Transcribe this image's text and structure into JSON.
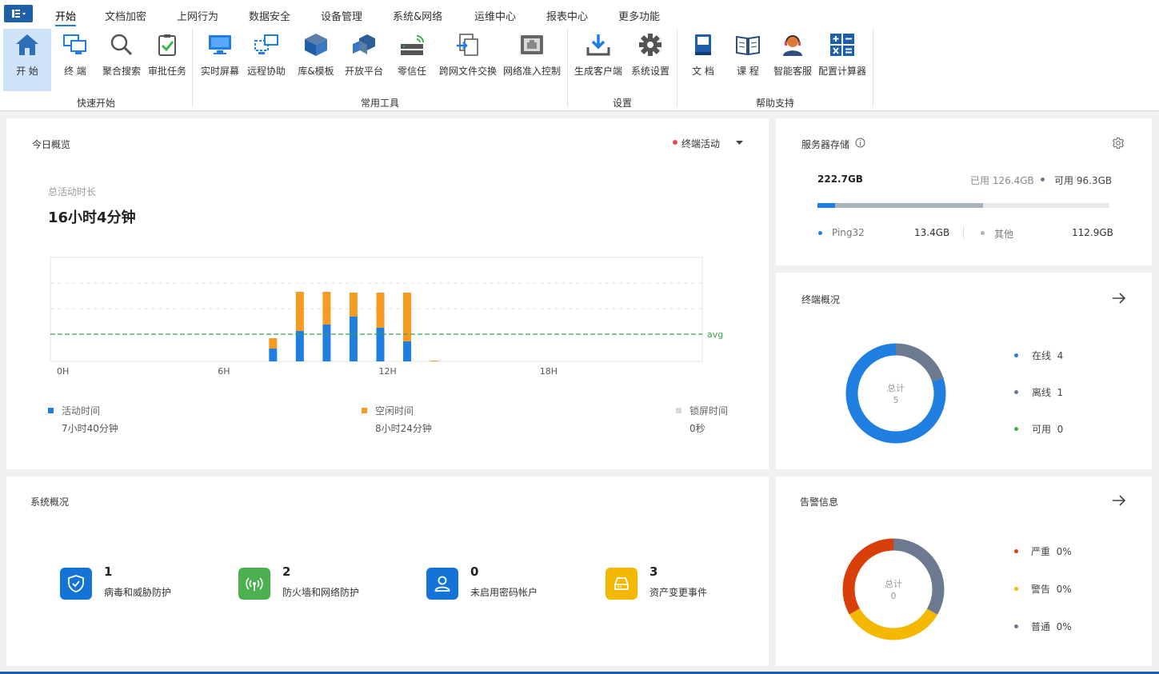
{
  "ribbon": {
    "tabs": [
      "开始",
      "文档加密",
      "上网行为",
      "数据安全",
      "设备管理",
      "系统&网络",
      "运维中心",
      "报表中心",
      "更多功能"
    ],
    "tools": [
      {
        "label": "开 始",
        "icon": "home-icon"
      },
      {
        "label": "终 端",
        "icon": "terminal-icon"
      },
      {
        "label": "聚合搜索",
        "icon": "search-icon"
      },
      {
        "label": "审批任务",
        "icon": "approval-icon"
      },
      {
        "label": "实时屏幕",
        "icon": "monitor-icon"
      },
      {
        "label": "远程协助",
        "icon": "remote-icon"
      },
      {
        "label": "库&模板",
        "icon": "library-icon"
      },
      {
        "label": "开放平台",
        "icon": "platform-icon"
      },
      {
        "label": "零信任",
        "icon": "zero-trust-icon"
      },
      {
        "label": "跨网文件交换",
        "icon": "file-exchange-icon"
      },
      {
        "label": "网络准入控制",
        "icon": "network-access-icon"
      },
      {
        "label": "生成客户端",
        "icon": "download-icon"
      },
      {
        "label": "系统设置",
        "icon": "gear-icon"
      },
      {
        "label": "文 档",
        "icon": "document-icon"
      },
      {
        "label": "课 程",
        "icon": "course-icon"
      },
      {
        "label": "智能客服",
        "icon": "support-icon"
      },
      {
        "label": "配置计算器",
        "icon": "calculator-icon"
      }
    ],
    "groups": [
      "快速开始",
      "常用工具",
      "设置",
      "帮助支持"
    ]
  },
  "today": {
    "title": "今日概览",
    "selector": "终端活动",
    "total_label": "总活动时长",
    "total_value": "16小时4分钟",
    "legend": [
      {
        "label": "活动时间",
        "value": "7小时40分钟",
        "color": "#1e7fe0"
      },
      {
        "label": "空闲时间",
        "value": "8小时24分钟",
        "color": "#f59a23"
      },
      {
        "label": "锁屏时间",
        "value": "0秒",
        "color": "#d9d9d9"
      }
    ]
  },
  "chart_data": {
    "type": "bar",
    "stacked": true,
    "x": [
      8,
      9,
      10,
      11,
      12,
      13,
      14
    ],
    "xticks": [
      "0H",
      "6H",
      "12H",
      "18H"
    ],
    "xlim": [
      0,
      24
    ],
    "series": [
      {
        "name": "活动时间",
        "color": "#1e7fe0",
        "values": [
          16,
          38,
          46,
          56,
          42,
          25,
          0
        ]
      },
      {
        "name": "空闲时间",
        "color": "#f59a23",
        "values": [
          13,
          49,
          41,
          30,
          44,
          61,
          1
        ]
      }
    ],
    "ylim": [
      0,
      130
    ],
    "avg_value": 34,
    "avg_label": "avg",
    "grid": true
  },
  "storage": {
    "title": "服务器存储",
    "total": "222.7GB",
    "used_label": "已用",
    "used": "126.4GB",
    "free_label": "可用",
    "free": "96.3GB",
    "used_gb": 126.4,
    "total_gb": 222.7,
    "ping32_gb": 13.4,
    "items": [
      {
        "label": "Ping32",
        "value": "13.4GB",
        "color": "#1e7fe0"
      },
      {
        "label": "其他",
        "value": "112.9GB",
        "color": "#a9b1bd"
      }
    ]
  },
  "terminal": {
    "title": "终端概况",
    "center_label": "总计",
    "center_value": "5",
    "items": [
      {
        "label": "在线",
        "value": "4",
        "count": 4,
        "color": "#1e7fe0"
      },
      {
        "label": "离线",
        "value": "1",
        "count": 1,
        "color": "#6b7a8f"
      },
      {
        "label": "可用",
        "value": "0",
        "count": 0,
        "color": "#3cb44b"
      }
    ]
  },
  "system": {
    "title": "系统概况",
    "stats": [
      {
        "value": "1",
        "label": "病毒和威胁防护",
        "color": "#1473d6",
        "icon": "shield-icon"
      },
      {
        "value": "2",
        "label": "防火墙和网络防护",
        "color": "#4caf50",
        "icon": "wifi-icon"
      },
      {
        "value": "0",
        "label": "未启用密码帐户",
        "color": "#1473d6",
        "icon": "user-icon"
      },
      {
        "value": "3",
        "label": "资产变更事件",
        "color": "#f5b800",
        "icon": "disk-icon"
      }
    ]
  },
  "alerts": {
    "title": "告警信息",
    "center_label": "总计",
    "center_value": "0",
    "items": [
      {
        "label": "严重",
        "value": "0%",
        "color": "#d93f0b"
      },
      {
        "label": "警告",
        "value": "0%",
        "color": "#f5b800"
      },
      {
        "label": "普通",
        "value": "0%",
        "color": "#6b7a8f"
      }
    ]
  }
}
